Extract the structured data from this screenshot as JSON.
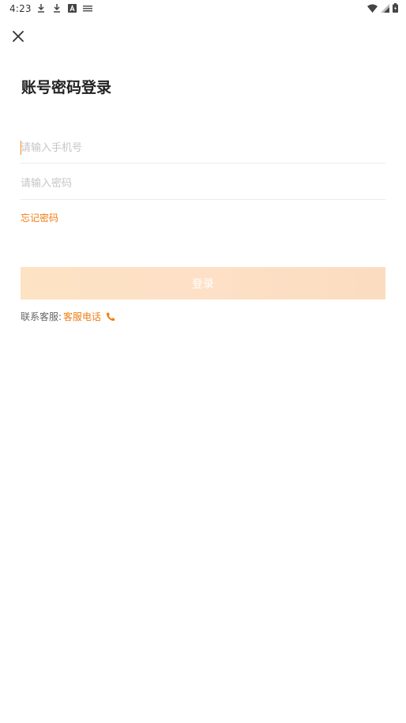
{
  "status_bar": {
    "time": "4:23",
    "left_icons": [
      "download-icon",
      "download-icon",
      "a-badge-icon",
      "notification-icon"
    ],
    "right_icons": [
      "wifi-icon",
      "signal-icon",
      "battery-icon"
    ]
  },
  "header": {
    "close_icon": "close-icon"
  },
  "page": {
    "title": "账号密码登录"
  },
  "form": {
    "phone_placeholder": "请输入手机号",
    "phone_value": "",
    "password_placeholder": "请输入密码",
    "password_value": "",
    "forgot_label": "忘记密码",
    "login_label": "登录"
  },
  "contact": {
    "prefix": "联系客服:",
    "link_label": "客服电话",
    "icon": "phone-icon"
  },
  "colors": {
    "accent": "#f07d14",
    "button_bg": "#fde0c6",
    "button_text": "#ffffff",
    "placeholder": "#c6c6c6",
    "divider": "#ebebeb"
  }
}
